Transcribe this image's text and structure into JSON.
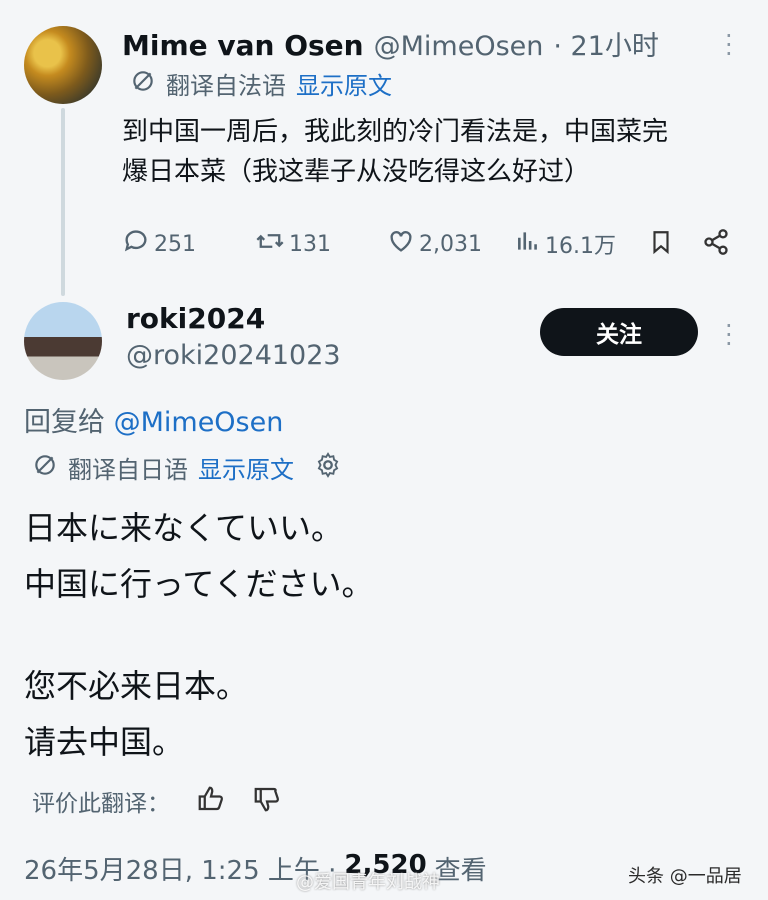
{
  "tweet1": {
    "name": "Mime van Osen",
    "handle": "@MimeOsen",
    "time": "· 21小时",
    "translated_from": "翻译自法语",
    "show_original": "显示原文",
    "text_line1": "到中国一周后，我此刻的冷门看法是，中国菜完",
    "text_line2": "爆日本菜（我这辈子从没吃得这么好过）",
    "metrics": {
      "replies": "251",
      "retweets": "131",
      "likes": "2,031",
      "views": "16.1万"
    }
  },
  "tweet2": {
    "name": "roki2024",
    "handle": "@roki20241023",
    "follow_label": "关注",
    "reply_to_prefix": "回复给",
    "reply_to_handle": "@MimeOsen",
    "translated_from": "翻译自日语",
    "show_original": "显示原文",
    "original_line1": "日本に来なくていい。",
    "original_line2": "中国に行ってください。",
    "translation_line1": "您不必来日本。",
    "translation_line2": "请去中国。",
    "rate_label": "评价此翻译：",
    "timestamp": "26年5月28日, 1:25 上午 ·",
    "views_count": "2,520",
    "views_label": "查看"
  },
  "watermarks": {
    "platform": "头条 @一品居",
    "weibo": "@爱国青年刘战神"
  },
  "colors": {
    "link": "#1d6fc6",
    "text": "#0f1419",
    "muted": "#536471",
    "button_bg": "#0f1419"
  }
}
